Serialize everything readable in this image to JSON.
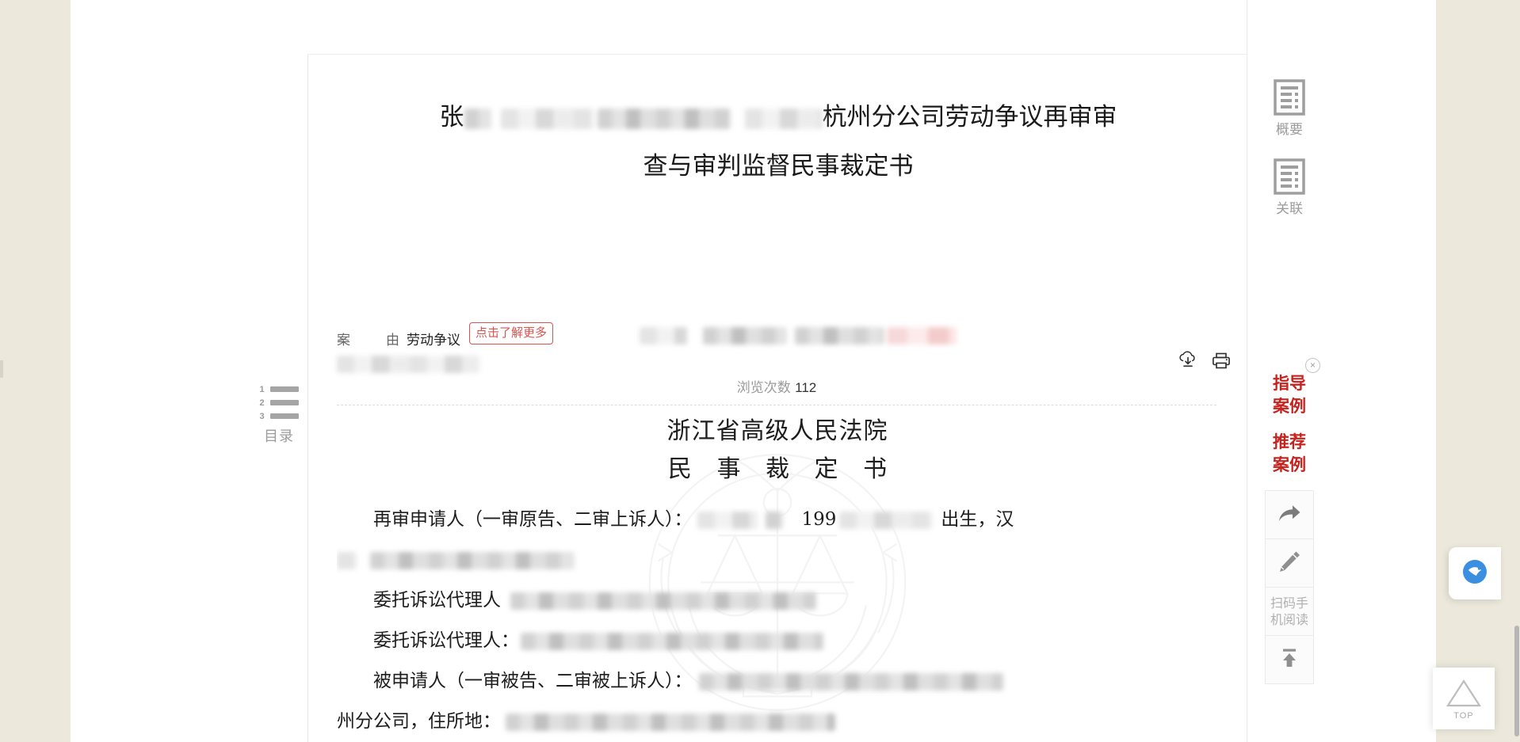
{
  "document": {
    "title_lines": [
      "杭州分公司劳动争议再审审",
      "查与审判监督民事裁定书"
    ],
    "title_prefix": "张",
    "meta": {
      "case_reason_key": "案",
      "case_reason_key2": "由",
      "case_reason_value": "劳动争议",
      "more_badge": "点击了解更多",
      "views_label": "浏览次数",
      "views_count": "112"
    },
    "actions": {
      "download": "下载",
      "print": "打印"
    },
    "body": {
      "court_name": "浙江省高级人民法院",
      "doc_kind": "民 事 裁 定 书",
      "line_applicant_label": "再审申请人（一审原告、二审上诉人）：",
      "line_applicant_tail_year": "199",
      "line_applicant_tail": "出生，汉",
      "line_agent_1": "委托诉讼代理人",
      "line_agent_2": "委托诉讼代理人：",
      "line_respondent_label": "被申请人（一审被告、二审被上诉人）：",
      "line_address_prefix": "州分公司，住所地："
    }
  },
  "left_rail": {
    "toc_label": "目录",
    "toc_numbers": [
      "1",
      "2",
      "3"
    ]
  },
  "right_rail": {
    "items": [
      {
        "label": "概要",
        "icon": "document-outline-icon"
      },
      {
        "label": "关联",
        "icon": "document-outline-icon"
      }
    ],
    "promo": {
      "close": "×",
      "links": [
        "指导\n案例",
        "推荐\n案例"
      ],
      "link_1_line_1": "指导",
      "link_1_line_2": "案例",
      "link_2_line_1": "推荐",
      "link_2_line_2": "案例"
    },
    "tools": [
      {
        "name": "share-icon",
        "label": ""
      },
      {
        "name": "edit-pencil-icon",
        "label": ""
      },
      {
        "name": "qr-scan-text",
        "label_line_1": "扫码手",
        "label_line_2": "机阅读"
      },
      {
        "name": "scroll-to-top-icon",
        "label": ""
      }
    ]
  },
  "floating": {
    "chat_label": "",
    "back_to_top_label": "TOP"
  },
  "colors": {
    "page_background": "#ece9dc",
    "card_background": "#ffffff",
    "accent_red": "#c6221e",
    "badge_red": "#d9534f",
    "muted_text": "#9b9b9b",
    "body_text": "#1d1d1d"
  }
}
